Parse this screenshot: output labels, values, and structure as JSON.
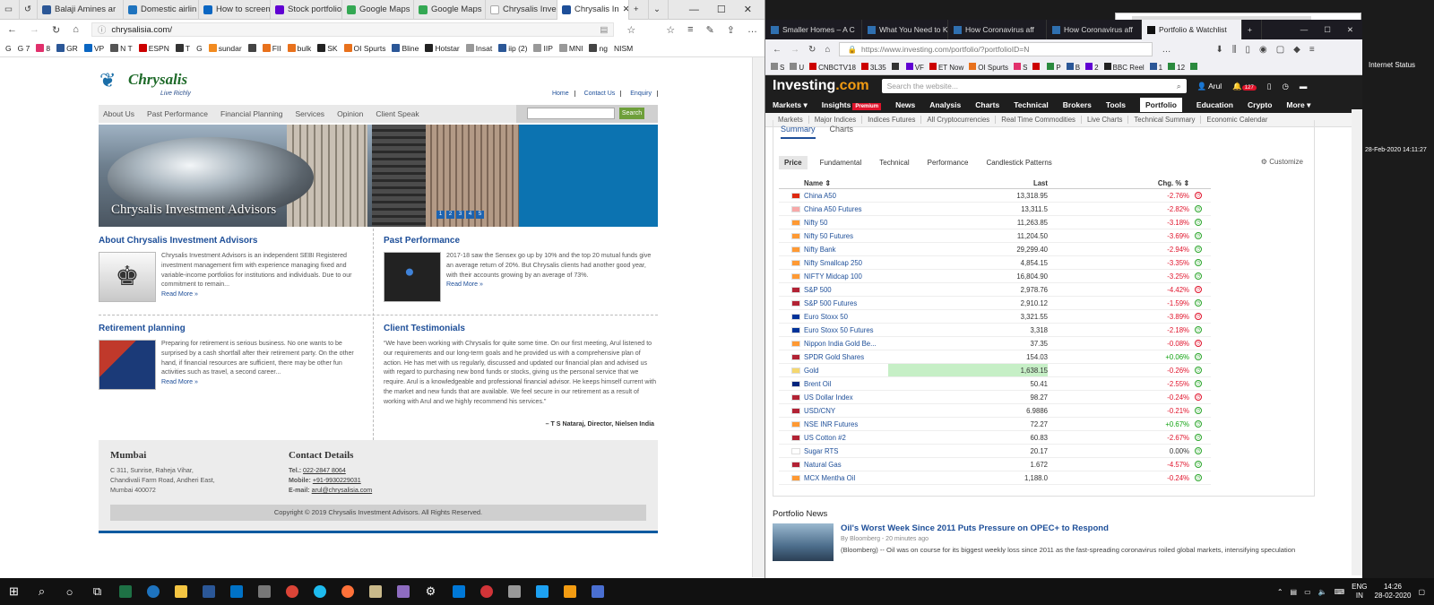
{
  "background_windows": {
    "bg2_title": "",
    "status_title": "Internet Status",
    "status_time": "28-Feb-2020 14:11:27"
  },
  "edge": {
    "tabs": [
      {
        "label": "Balaji Amines ar",
        "color": "#2b5797"
      },
      {
        "label": "Domestic airlin",
        "color": "#1e73be"
      },
      {
        "label": "How to screen s",
        "color": "#0a66c2"
      },
      {
        "label": "Stock portfolio",
        "color": "#6001d2"
      },
      {
        "label": "Google Maps",
        "color": "#34a853"
      },
      {
        "label": "Google Maps",
        "color": "#34a853"
      },
      {
        "label": "Chrysalis Invest",
        "color": "#ffffff"
      },
      {
        "label": "Chrysalis In",
        "color": "#1e4f99"
      }
    ],
    "url": "chrysalisia.com/",
    "favorites": [
      "G",
      "G 7",
      "8",
      "GR",
      "VP",
      "N T",
      "ESPN",
      "T",
      "G",
      "sundar",
      "FII",
      "bulk",
      "SK",
      "OI Spurts",
      "Bline",
      "Hotstar",
      "Insat",
      "iip (2)",
      "IIP",
      "MNI",
      "ng",
      "NISM"
    ]
  },
  "chrysalis": {
    "logo_name": "Chrysalis",
    "logo_tagline": "Live Richly",
    "toplinks": [
      "Home",
      "Contact Us",
      "Enquiry"
    ],
    "nav": [
      "About Us",
      "Past Performance",
      "Financial Planning",
      "Services",
      "Opinion",
      "Client Speak"
    ],
    "search_button": "Search",
    "banner_caption": "Chrysalis Investment Advisors",
    "banner_dots": [
      "1",
      "2",
      "3",
      "4",
      "5"
    ],
    "about": {
      "title": "About Chrysalis Investment Advisors",
      "text": "Chrysalis Investment Advisors is an independent SEBI Registered investment management firm with experience managing fixed and variable-income portfolios for institutions and individuals. Due to our commitment to remain...",
      "more": "Read More »"
    },
    "perf": {
      "title": "Past Performance",
      "text": "2017-18 saw the Sensex go up by 10% and the top 20 mutual funds give an average return of 20%. But Chrysalis clients had another good year, with their accounts growing by an average of 73%.",
      "more": "Read More »"
    },
    "retire": {
      "title": "Retirement planning",
      "text": "Preparing for retirement is serious business. No one wants to be surprised by a cash shortfall after their retirement party. On the other hand, if financial resources are sufficient, there may be other fun activities such as travel, a second career...",
      "more": "Read More »"
    },
    "testimonial": {
      "title": "Client Testimonials",
      "text": "“We have been working with Chrysalis for quite some time. On our first meeting, Arul listened to our requirements and our long-term goals and he provided us with a comprehensive plan of action. He has met with us regularly, discussed and updated our financial plan and advised us with regard to purchasing new bond funds or stocks, giving us the personal service that we require. Arul is a knowledgeable and professional financial advisor. He keeps himself current with the market and new funds that are available. We feel secure in our retirement as a result of working with Arul and we highly recommend his services.”",
      "by": "– T S Nataraj, Director, Nielsen India"
    },
    "footer": {
      "city": "Mumbai",
      "address": [
        "C 311, Sunrise, Raheja Vihar,",
        "Chandivali Farm Road, Andheri East,",
        "Mumbai 400072"
      ],
      "contact_title": "Contact Details",
      "tel_label": "Tel.:",
      "tel": "022-2847 8064",
      "mobile_label": "Mobile:",
      "mobile": "+91-9930229031",
      "email_label": "E-mail:",
      "email": "arul@chrysalisia.com",
      "copyright": "Copyright © 2019 Chrysalis Investment Advisors. All Rights Reserved."
    }
  },
  "firefox": {
    "tabs": [
      "Smaller Homes – A C",
      "What You Need to Kn",
      "How Coronavirus aff",
      "How Coronavirus aff",
      "Portfolio & Watchlist"
    ],
    "url": "https://www.investing.com/portfolio/?portfolioID=N",
    "favorites": [
      "S",
      "U",
      "CNBCTV18",
      "3L35",
      "",
      "VF",
      "ET Now",
      "OI Spurts",
      "S",
      "",
      "P",
      "B",
      "2",
      "BBC Reel",
      "1",
      "12",
      ""
    ]
  },
  "investing": {
    "logo": "Investing",
    "logo_suffix": ".com",
    "search_placeholder": "Search the website...",
    "user": "Arul",
    "notifications": "127",
    "nav": [
      "Markets",
      "Insights",
      "News",
      "Analysis",
      "Charts",
      "Technical",
      "Brokers",
      "Tools",
      "Portfolio",
      "Education",
      "Crypto",
      "More"
    ],
    "premium": "Premium",
    "sub": [
      "Markets",
      "Major Indices",
      "Indices Futures",
      "All Cryptocurrencies",
      "Real Time Commodities",
      "Live Charts",
      "Technical Summary",
      "Economic Calendar"
    ],
    "panel_tabs": [
      "Summary",
      "Charts"
    ],
    "view_tabs": [
      "Price",
      "Fundamental",
      "Technical",
      "Performance",
      "Candlestick Patterns"
    ],
    "customize": "Customize",
    "col_name": "Name",
    "col_last": "Last",
    "col_chg": "Chg. %",
    "rows": [
      {
        "name": "China A50",
        "last": "13,318.95",
        "chg": "-2.76%",
        "flag": "#de2910",
        "status": "red"
      },
      {
        "name": "China A50 Futures",
        "last": "13,311.5",
        "chg": "-2.82%",
        "flag": "#f7a8a8",
        "status": "green"
      },
      {
        "name": "Nifty 50",
        "last": "11,263.85",
        "chg": "-3.18%",
        "flag": "#ff9933",
        "status": "green"
      },
      {
        "name": "Nifty 50 Futures",
        "last": "11,204.50",
        "chg": "-3.69%",
        "flag": "#ff9933",
        "status": "green"
      },
      {
        "name": "Nifty Bank",
        "last": "29,299.40",
        "chg": "-2.94%",
        "flag": "#ff9933",
        "status": "green"
      },
      {
        "name": "Nifty Smallcap 250",
        "last": "4,854.15",
        "chg": "-3.35%",
        "flag": "#ff9933",
        "status": "green"
      },
      {
        "name": "NIFTY Midcap 100",
        "last": "16,804.90",
        "chg": "-3.25%",
        "flag": "#ff9933",
        "status": "green"
      },
      {
        "name": "S&P 500",
        "last": "2,978.76",
        "chg": "-4.42%",
        "flag": "#b22234",
        "status": "red"
      },
      {
        "name": "S&P 500 Futures",
        "last": "2,910.12",
        "chg": "-1.59%",
        "flag": "#b22234",
        "status": "green"
      },
      {
        "name": "Euro Stoxx 50",
        "last": "3,321.55",
        "chg": "-3.89%",
        "flag": "#003399",
        "status": "red"
      },
      {
        "name": "Euro Stoxx 50 Futures",
        "last": "3,318",
        "chg": "-2.18%",
        "flag": "#003399",
        "status": "green"
      },
      {
        "name": "Nippon India Gold Be...",
        "last": "37.35",
        "chg": "-0.08%",
        "flag": "#ff9933",
        "status": "red"
      },
      {
        "name": "SPDR Gold Shares",
        "last": "154.03",
        "chg": "+0.06%",
        "flag": "#b22234",
        "status": "green"
      },
      {
        "name": "Gold",
        "last": "1,638.15",
        "chg": "-0.26%",
        "flag": "#f5d76e",
        "status": "green"
      },
      {
        "name": "Brent Oil",
        "last": "50.41",
        "chg": "-2.55%",
        "flag": "#00247d",
        "status": "green"
      },
      {
        "name": "US Dollar Index",
        "last": "98.27",
        "chg": "-0.24%",
        "flag": "#b22234",
        "status": "red"
      },
      {
        "name": "USD/CNY",
        "last": "6.9886",
        "chg": "-0.21%",
        "flag": "#b22234",
        "status": "green"
      },
      {
        "name": "NSE INR Futures",
        "last": "72.27",
        "chg": "+0.67%",
        "flag": "#ff9933",
        "status": "green"
      },
      {
        "name": "US Cotton #2",
        "last": "60.83",
        "chg": "-2.67%",
        "flag": "#b22234",
        "status": "green"
      },
      {
        "name": "Sugar RTS",
        "last": "20.17",
        "chg": "0.00%",
        "flag": "#ffffff",
        "status": "green"
      },
      {
        "name": "Natural Gas",
        "last": "1.672",
        "chg": "-4.57%",
        "flag": "#b22234",
        "status": "green"
      },
      {
        "name": "MCX Mentha Oil",
        "last": "1,188.0",
        "chg": "-0.24%",
        "flag": "#ff9933",
        "status": "green"
      }
    ],
    "news_title": "Portfolio News",
    "news_headline": "Oil's Worst Week Since 2011 Puts Pressure on OPEC+ to Respond",
    "news_by": "By Bloomberg - 20 minutes ago",
    "news_summary": "(Bloomberg) -- Oil was on course for its biggest weekly loss since 2011 as the fast-spreading coronavirus roiled global markets, intensifying speculation"
  },
  "taskbar": {
    "lang": "ENG",
    "region": "IN",
    "time": "14:26",
    "date": "28-02-2020"
  }
}
